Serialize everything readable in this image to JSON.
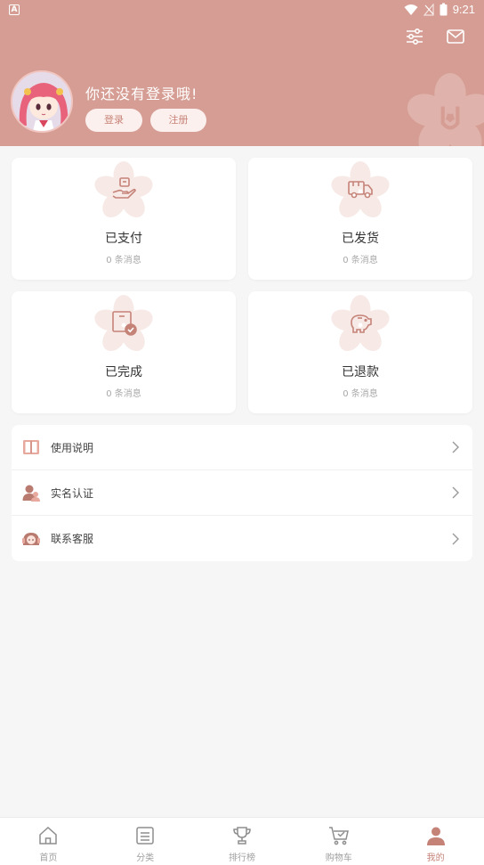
{
  "status_bar": {
    "time": "9:21",
    "left_badge": "A"
  },
  "colors": {
    "header": "#d59d93",
    "accent": "#c58378",
    "flower": "#f7e9e6"
  },
  "header": {
    "settings_icon": "sliders-icon",
    "message_icon": "mail-icon",
    "welcome_text": "你还没有登录哦!",
    "login_label": "登录",
    "register_label": "注册"
  },
  "orders": [
    {
      "title": "已支付",
      "sub": "0 条消息",
      "icon": "hand-coin-icon"
    },
    {
      "title": "已发货",
      "sub": "0 条消息",
      "icon": "truck-icon"
    },
    {
      "title": "已完成",
      "sub": "0 条消息",
      "icon": "box-check-icon"
    },
    {
      "title": "已退款",
      "sub": "0 条消息",
      "icon": "piggy-bank-icon"
    }
  ],
  "menu": [
    {
      "label": "使用说明",
      "icon": "book-icon"
    },
    {
      "label": "实名认证",
      "icon": "users-icon"
    },
    {
      "label": "联系客服",
      "icon": "support-agent-icon"
    }
  ],
  "tabs": [
    {
      "label": "首页",
      "icon": "home-icon"
    },
    {
      "label": "分类",
      "icon": "list-icon"
    },
    {
      "label": "排行榜",
      "icon": "trophy-icon"
    },
    {
      "label": "购物车",
      "icon": "cart-icon"
    },
    {
      "label": "我的",
      "icon": "user-icon",
      "active": true
    }
  ]
}
